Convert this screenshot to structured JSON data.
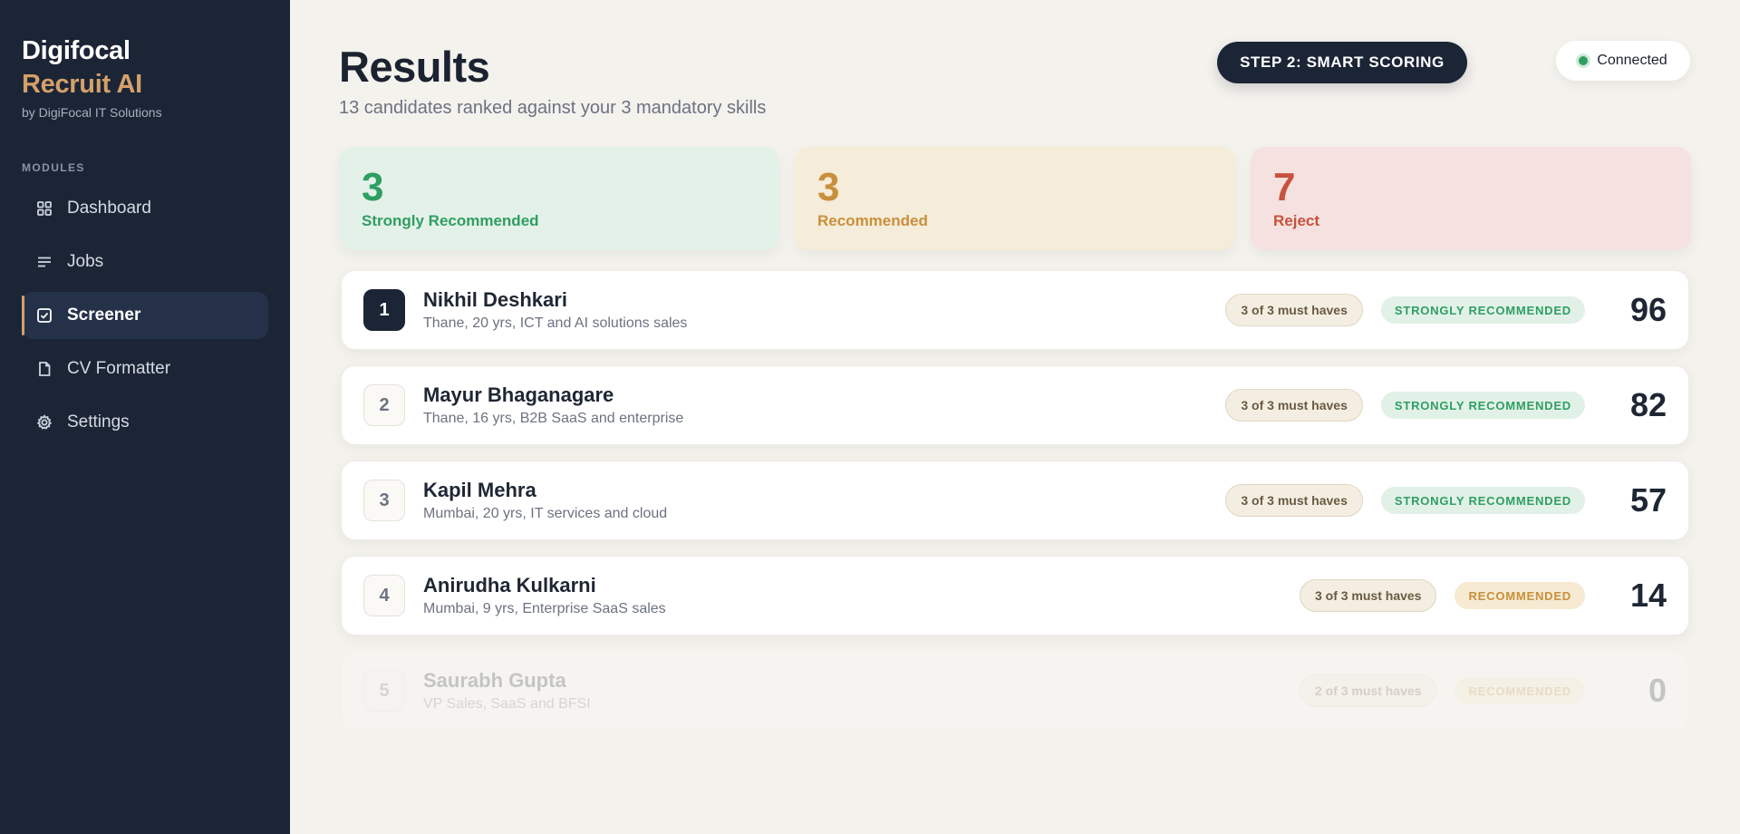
{
  "brand": {
    "line1": "Digifocal",
    "line2": "Recruit AI",
    "sub": "by DigiFocal IT Solutions"
  },
  "sidebar": {
    "section_label": "MODULES",
    "items": [
      {
        "label": "Dashboard",
        "icon": "grid-icon"
      },
      {
        "label": "Jobs",
        "icon": "list-icon"
      },
      {
        "label": "Screener",
        "icon": "checkbox-icon",
        "active": true
      },
      {
        "label": "CV Formatter",
        "icon": "document-icon"
      },
      {
        "label": "Settings",
        "icon": "gear-icon"
      }
    ]
  },
  "header": {
    "title": "Results",
    "subtitle": "13 candidates ranked against your 3 mandatory skills",
    "step_label": "STEP 2: SMART SCORING",
    "status_label": "Connected"
  },
  "colors": {
    "sidebar_bg": "#1b2536",
    "accent": "#d4a06a",
    "green": "#2f9e63",
    "amber": "#c8903c",
    "red": "#c7523d"
  },
  "stats": [
    {
      "count": "3",
      "label": "Strongly Recommended"
    },
    {
      "count": "3",
      "label": "Recommended"
    },
    {
      "count": "7",
      "label": "Reject"
    }
  ],
  "candidates": [
    {
      "rank": "1",
      "name": "Nikhil Deshkari",
      "meta": "Thane, 20 yrs, ICT and AI solutions sales",
      "musts": "3 of 3 must haves",
      "verdict": "STRONGLY RECOMMENDED",
      "score": "96"
    },
    {
      "rank": "2",
      "name": "Mayur Bhaganagare",
      "meta": "Thane, 16 yrs, B2B SaaS and enterprise",
      "musts": "3 of 3 must haves",
      "verdict": "STRONGLY RECOMMENDED",
      "score": "82"
    },
    {
      "rank": "3",
      "name": "Kapil Mehra",
      "meta": "Mumbai, 20 yrs, IT services and cloud",
      "musts": "3 of 3 must haves",
      "verdict": "STRONGLY RECOMMENDED",
      "score": "57"
    },
    {
      "rank": "4",
      "name": "Anirudha Kulkarni",
      "meta": "Mumbai, 9 yrs, Enterprise SaaS sales",
      "musts": "3 of 3 must haves",
      "verdict": "RECOMMENDED",
      "score": "14"
    },
    {
      "rank": "5",
      "name": "Saurabh Gupta",
      "meta": "VP Sales, SaaS and BFSI",
      "musts": "2 of 3 must haves",
      "verdict": "RECOMMENDED",
      "score": "0"
    }
  ]
}
